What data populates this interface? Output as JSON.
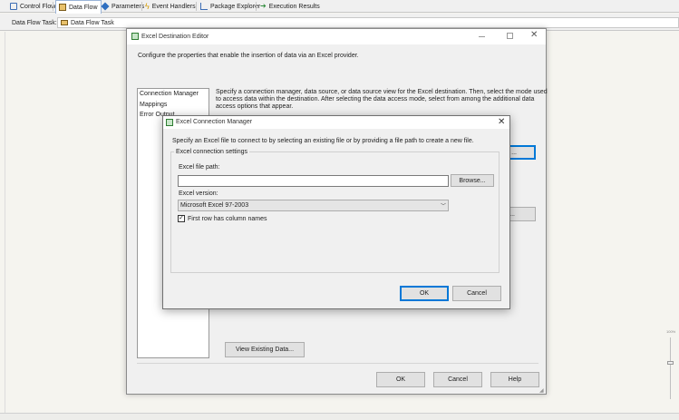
{
  "designer_tabs": [
    {
      "label": "Control Flow",
      "icon": "control-flow-icon"
    },
    {
      "label": "Data Flow",
      "icon": "data-flow-icon"
    },
    {
      "label": "Parameters",
      "icon": "parameters-icon"
    },
    {
      "label": "Event Handlers",
      "icon": "event-handlers-icon"
    },
    {
      "label": "Package Explorer",
      "icon": "package-explorer-icon"
    },
    {
      "label": "Execution Results",
      "icon": "execution-results-icon"
    }
  ],
  "task_bar": {
    "label": "Data Flow Task:",
    "selected": "Data Flow Task"
  },
  "editor": {
    "title": "Excel Destination Editor",
    "description": "Configure the properties that enable the insertion of data via an Excel provider.",
    "nav_items": [
      "Connection Manager",
      "Mappings",
      "Error Output"
    ],
    "instructions": [
      "Specify a connection manager, data source, or data source view for the Excel destination. Then, select the mode used",
      "to access data within the destination. After selecting the data access mode, select from among the additional data",
      "access options that appear."
    ],
    "partial_new_button": "...",
    "view_existing_button": "View Existing Data...",
    "ok_button": "OK",
    "cancel_button": "Cancel",
    "help_button": "Help"
  },
  "conn_dialog": {
    "title": "Excel Connection Manager",
    "description": "Specify an Excel file to connect to by selecting an existing file or by providing a file path to create a new file.",
    "group_label": "Excel connection settings",
    "file_path_label": "Excel file path:",
    "file_path_value": "",
    "browse_button": "Browse...",
    "version_label": "Excel version:",
    "version_value": "Microsoft Excel 97-2003",
    "first_row_label": "First row has column names",
    "first_row_checked": true,
    "ok_button": "OK",
    "cancel_button": "Cancel"
  },
  "zoom": {
    "label": "100%"
  },
  "colors": {
    "default_button_border": "#0078d7",
    "background": "#f5f4ef"
  }
}
